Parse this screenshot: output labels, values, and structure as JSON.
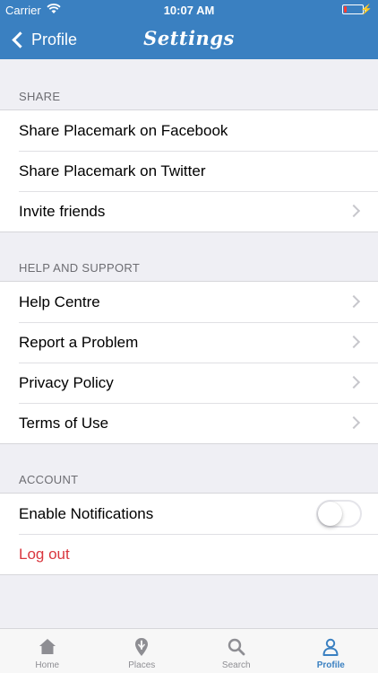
{
  "status_bar": {
    "carrier": "Carrier",
    "time": "10:07 AM",
    "battery_level": 0.15,
    "battery_color": "#ff3b30"
  },
  "nav": {
    "back_label": "Profile",
    "title": "Settings",
    "color": "#3a80c1"
  },
  "sections": {
    "share": {
      "header": "SHARE",
      "items": [
        {
          "label": "Share Placemark on Facebook"
        },
        {
          "label": "Share Placemark on Twitter"
        },
        {
          "label": "Invite friends"
        }
      ]
    },
    "help": {
      "header": "HELP AND SUPPORT",
      "items": [
        {
          "label": "Help Centre"
        },
        {
          "label": "Report a Problem"
        },
        {
          "label": "Privacy Policy"
        },
        {
          "label": "Terms of Use"
        }
      ]
    },
    "account": {
      "header": "ACCOUNT",
      "notifications_label": "Enable Notifications",
      "notifications_enabled": false,
      "logout_label": "Log out",
      "logout_color": "#d9363e"
    }
  },
  "tab_bar": {
    "tabs": [
      {
        "label": "Home",
        "icon": "home-icon"
      },
      {
        "label": "Places",
        "icon": "places-pin-icon"
      },
      {
        "label": "Search",
        "icon": "search-icon"
      },
      {
        "label": "Profile",
        "icon": "profile-icon",
        "active": true
      }
    ]
  }
}
